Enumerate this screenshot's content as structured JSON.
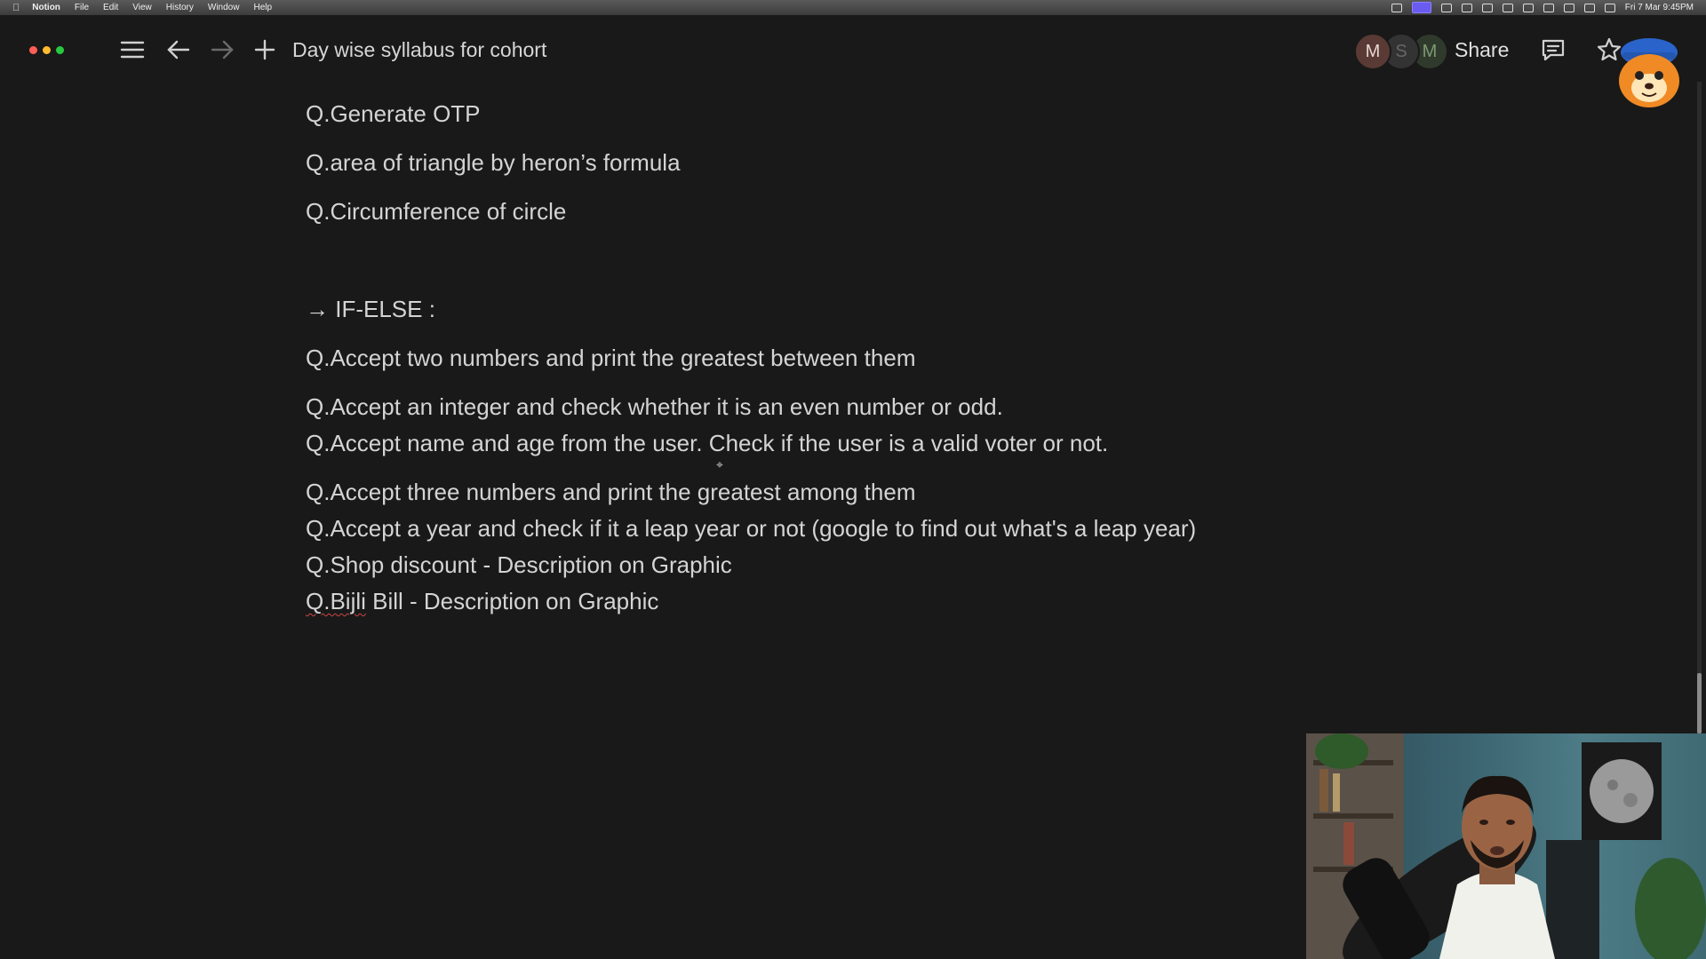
{
  "menubar": {
    "app_name": "Notion",
    "items": [
      "File",
      "Edit",
      "View",
      "History",
      "Window",
      "Help"
    ],
    "clock": "Fri 7 Mar  9:45PM"
  },
  "topbar": {
    "page_title": "Day wise syllabus for cohort",
    "share_label": "Share",
    "avatars": [
      "M",
      "S",
      "M"
    ]
  },
  "content": {
    "questions_top": [
      "Q.Generate OTP",
      "Q.area of triangle by heron’s formula",
      "Q.Circumference of circle"
    ],
    "section_heading": "→ IF-ELSE :",
    "questions_ifelse": [
      "Q.Accept two numbers and print the greatest between them",
      "Q.Accept an integer and check whether it is an even number or odd.",
      "Q.Accept name and age from the user. Check if the user is a valid voter or not.",
      "Q.Accept three numbers and print the greatest among them",
      "Q.Accept a year and check if it a leap year or not (google to find out what's a leap year)",
      "Q.Shop discount - Description on Graphic"
    ],
    "last_question_prefix": "Q.Bijli",
    "last_question_rest": " Bill - Description on Graphic"
  },
  "colors": {
    "background": "#191919",
    "text": "#d4d4d4",
    "menubar": "#3c3c3c"
  }
}
